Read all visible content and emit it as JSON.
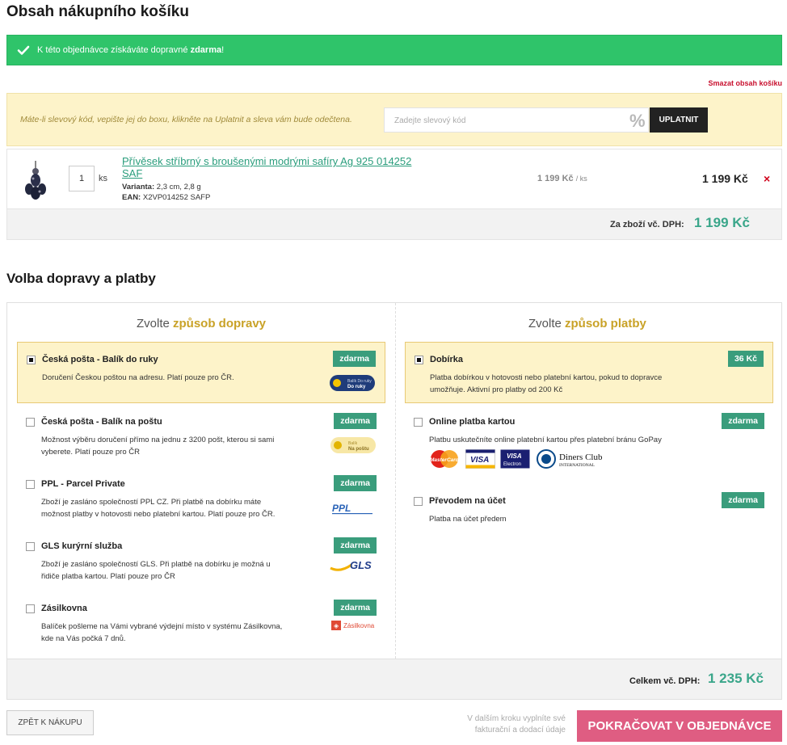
{
  "cart": {
    "title": "Obsah nákupního košíku",
    "banner_text": "K této objednávce získáváte dopravné ",
    "banner_bold": "zdarma",
    "banner_end": "!",
    "clear_label": "Smazat obsah košíku",
    "coupon_hint": "Máte-li slevový kód, vepište jej do boxu, klikněte na Uplatnit a sleva vám bude odečtena.",
    "coupon_placeholder": "Zadejte slevový kód",
    "coupon_percent": "%",
    "coupon_apply": "UPLATNIT",
    "item": {
      "name": "Přívěsek stříbrný s broušenými modrými safíry Ag 925 014252 SAF",
      "qty": "1",
      "unit": "ks",
      "variant_label": "Varianta:",
      "variant_value": "2,3 cm, 2,8 g",
      "ean_label": "EAN:",
      "ean_value": "X2VP014252 SAFP",
      "unit_price": "1 199 Kč",
      "unit_price_suffix": "/ ks",
      "total_price": "1 199 Kč",
      "remove": "×"
    },
    "subtotal_label": "Za zboží vč. DPH:",
    "subtotal_value": "1 199 Kč"
  },
  "shipping_payment": {
    "title": "Volba dopravy a platby",
    "shipping_head_pre": "Zvolte ",
    "shipping_head_hl": "způsob dopravy",
    "payment_head_pre": "Zvolte ",
    "payment_head_hl": "způsob platby",
    "shipping": [
      {
        "name": "Česká pošta - Balík do ruky",
        "desc": "Doručení Českou poštou na adresu. Platí pouze pro ČR.",
        "price": "zdarma",
        "logo": "Balík Do ruky"
      },
      {
        "name": "Česká pošta - Balík na poštu",
        "desc": "Možnost výběru doručení přímo na jednu z 3200 pošt, kterou si sami vyberete. Platí pouze pro ČR",
        "price": "zdarma",
        "logo": "Balík Na poštu"
      },
      {
        "name": "PPL - Parcel Private",
        "desc": "Zboží je zasláno společností PPL CZ. Při platbě na dobírku máte možnost platby v hotovosti nebo platební kartou. Platí pouze pro ČR.",
        "price": "zdarma",
        "logo": "PPL"
      },
      {
        "name": "GLS kurýrní služba",
        "desc": "Zboží je zasláno společností GLS. Při platbě na dobírku je možná u řidiče platba kartou. Platí pouze pro ČR",
        "price": "zdarma",
        "logo": "GLS"
      },
      {
        "name": "Zásilkovna",
        "desc": "Balíček pošleme na Vámi vybrané výdejní místo v systému Zásilkovna, kde na Vás počká 7 dnů.",
        "price": "zdarma",
        "logo": "Zásilkovna"
      }
    ],
    "payment": [
      {
        "name": "Dobírka",
        "desc": "Platba dobírkou v hotovosti nebo platební kartou, pokud to dopravce umožňuje. Aktivní pro platby od 200 Kč",
        "price": "36 Kč"
      },
      {
        "name": "Online platba kartou",
        "desc": "Platbu uskutečníte online platební kartou přes platební bránu GoPay",
        "price": "zdarma",
        "cards": [
          "MasterCard",
          "VISA",
          "VISA Electron",
          "Diners Club INTERNATIONAL"
        ]
      },
      {
        "name": "Převodem na účet",
        "desc": "Platba na účet předem",
        "price": "zdarma"
      }
    ],
    "total_label": "Celkem vč. DPH:",
    "total_value": "1 235 Kč"
  },
  "footer": {
    "back_label": "ZPĚT K NÁKUPU",
    "next_note": "V dalším kroku vyplníte své fakturační a dodací údaje",
    "next_label": "POKRAČOVAT V OBJEDNÁVCE"
  },
  "colors": {
    "banner": "#2fc46a",
    "accent_green": "#3a9d7c",
    "highlight_gold": "#c9a227",
    "selected_bg": "#fdf3c9",
    "cta_pink": "#df5d82",
    "danger_red": "#d0021b"
  }
}
